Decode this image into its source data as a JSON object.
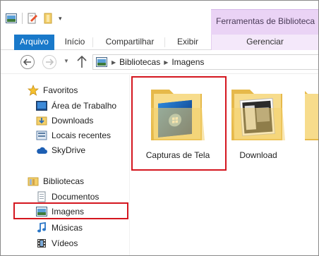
{
  "ribbon": {
    "context_title": "Ferramentas de Biblioteca",
    "tabs": [
      "Arquivo",
      "Início",
      "Compartilhar",
      "Exibir",
      "Gerenciar"
    ]
  },
  "address": {
    "crumbs": [
      "Bibliotecas",
      "Imagens"
    ]
  },
  "nav": {
    "favorites_label": "Favoritos",
    "favorites": [
      "Área de Trabalho",
      "Downloads",
      "Locais recentes",
      "SkyDrive"
    ],
    "libraries_label": "Bibliotecas",
    "libraries": [
      "Documentos",
      "Imagens",
      "Músicas",
      "Vídeos"
    ],
    "selected": "Imagens"
  },
  "content": {
    "items": [
      {
        "label": "Capturas de Tela",
        "icon": "folder-with-windows-wallpaper-icon"
      },
      {
        "label": "Download",
        "icon": "folder-with-photos-icon"
      }
    ]
  },
  "colors": {
    "file_tab": "#1979ca",
    "context_tab": "#ead3f5",
    "highlight": "#d4161f"
  }
}
